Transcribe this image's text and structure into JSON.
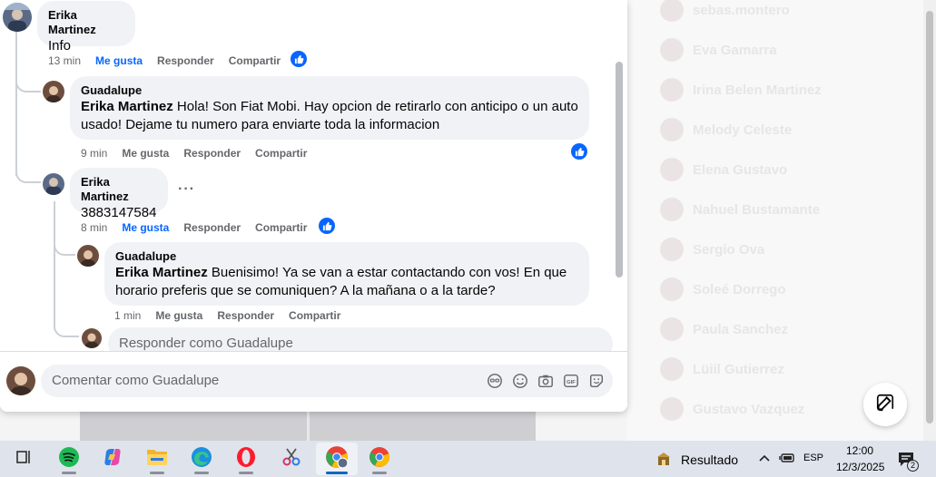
{
  "contacts": [
    {
      "name": "sebas.montero"
    },
    {
      "name": "Eva Gamarra"
    },
    {
      "name": "Irina Belen Martinez"
    },
    {
      "name": "Melody Celeste"
    },
    {
      "name": "Elena Gustavo"
    },
    {
      "name": "Nahuel Bustamante"
    },
    {
      "name": "Sergio Ova"
    },
    {
      "name": "Soleé Dorrego"
    },
    {
      "name": "Paula Sanchez"
    },
    {
      "name": "Lüiil Gutierrez"
    },
    {
      "name": "Gustavo Vazquez"
    }
  ],
  "comments": [
    {
      "author": "Erika Martinez",
      "text": "Info",
      "actions": {
        "time": "13 min",
        "like": "Me gusta",
        "reply": "Responder",
        "share": "Compartir"
      },
      "liked": true
    },
    {
      "author": "Guadalupe",
      "mention": "Erika Martinez",
      "text": "Hola! Son Fiat Mobi. Hay opcion de retirarlo con anticipo o un auto usado! Dejame tu numero para enviarte toda la informacion",
      "actions": {
        "time": "9 min",
        "like": "Me gusta",
        "reply": "Responder",
        "share": "Compartir"
      },
      "liked": false
    },
    {
      "author": "Erika Martinez",
      "text": "3883147584",
      "more": "···",
      "actions": {
        "time": "8 min",
        "like": "Me gusta",
        "reply": "Responder",
        "share": "Compartir"
      },
      "liked": true
    },
    {
      "author": "Guadalupe",
      "mention": "Erika Martinez",
      "text": "Buenisimo! Ya se van a estar contactando con vos! En que horario preferis que se comuniquen? A la mañana o a la tarde?",
      "actions": {
        "time": "1 min",
        "like": "Me gusta",
        "reply": "Responder",
        "share": "Compartir"
      },
      "liked": false
    }
  ],
  "reply_placeholder": "Responder como Guadalupe",
  "comment_placeholder": "Comentar como Guadalupe",
  "composer_tools": [
    "avatar-sticker-icon",
    "emoji-icon",
    "camera-icon",
    "gif-icon",
    "sticker-icon"
  ],
  "taskbar": {
    "apps": [
      "task-view-icon",
      "spotify-icon",
      "copilot-icon",
      "file-explorer-icon",
      "edge-icon",
      "opera-icon",
      "snipping-tool-icon",
      "chrome-profile-icon",
      "chrome-icon"
    ],
    "search_result_label": "Resultado",
    "language": "ESP",
    "time": "12:00",
    "date": "12/3/2025",
    "notification_count": "2"
  },
  "colors": {
    "accent": "#0866ff",
    "bubble": "#f0f2f5",
    "muted": "#65676b"
  }
}
